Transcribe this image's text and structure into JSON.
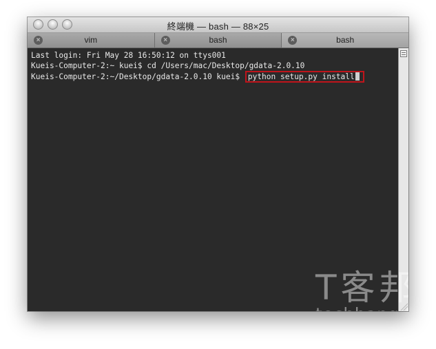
{
  "window": {
    "title": "終端機 — bash — 88×25"
  },
  "tabs": [
    {
      "label": "vim",
      "close_icon": "×"
    },
    {
      "label": "bash",
      "close_icon": "×"
    },
    {
      "label": "bash",
      "close_icon": "×",
      "active": true
    }
  ],
  "terminal": {
    "lines": [
      "Last login: Fri May 28 16:50:12 on ttys001",
      "Kueis-Computer-2:~ kuei$ cd /Users/mac/Desktop/gdata-2.0.10",
      "Kueis-Computer-2:~/Desktop/gdata-2.0.10 kuei$ "
    ],
    "highlighted_command": "python setup.py install",
    "highlight_color": "#c0141b"
  },
  "watermark": {
    "cn": "T客邦",
    "en": "techbang.tw"
  },
  "icons": [
    "close-icon",
    "minimize-icon",
    "zoom-icon",
    "tab-close-icon",
    "scrollback-icon",
    "resize-grip-icon"
  ]
}
